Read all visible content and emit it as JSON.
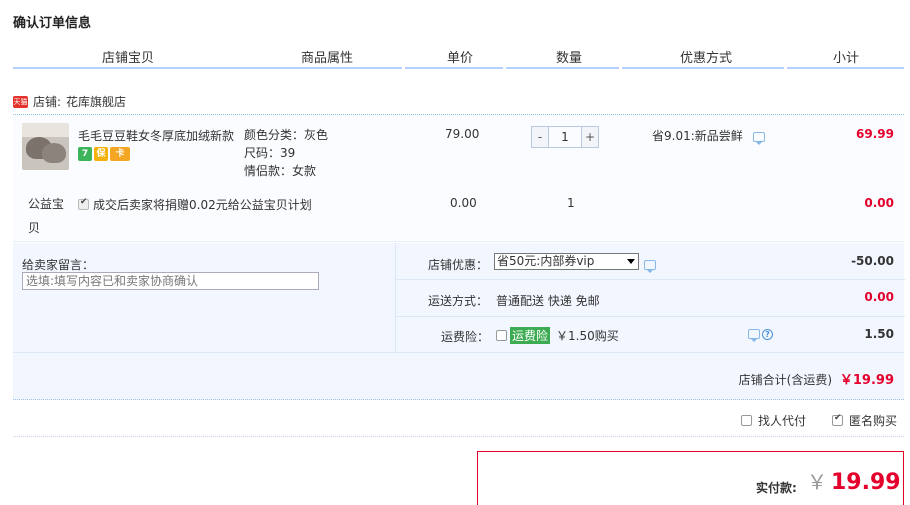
{
  "page": {
    "title": "确认订单信息"
  },
  "columns": [
    "店铺宝贝",
    "商品属性",
    "单价",
    "数量",
    "优惠方式",
    "小计"
  ],
  "shop": {
    "badge": "天猫",
    "label": "店铺:",
    "name": "花库旗舰店"
  },
  "item": {
    "title": "毛毛豆豆鞋女冬厚底加绒新款",
    "service_icons": [
      "7-day-return-icon",
      "guarantee-icon",
      "credit-card-icon"
    ],
    "service_glyphs": [
      "7",
      "保",
      "卡"
    ],
    "attrs": [
      "颜色分类：灰色",
      "尺码：39",
      "情侣款：女款"
    ],
    "price": "79.00",
    "qty_minus": "-",
    "qty": "1",
    "qty_plus": "+",
    "promo": "省9.01:新品尝鲜",
    "subtotal": "69.99"
  },
  "charity": {
    "label": "公益宝贝",
    "text": "成交后卖家将捐赠0.02元给公益宝贝计划",
    "price": "0.00",
    "qty": "1",
    "subtotal": "0.00"
  },
  "message": {
    "label": "给卖家留言：",
    "placeholder": "选填:填写内容已和卖家协商确认"
  },
  "discount": {
    "label": "店铺优惠：",
    "selected": "省50元:内部券vip",
    "amount": "-50.00"
  },
  "shipping": {
    "label": "运送方式：",
    "value": "普通配送 快递 免邮",
    "amount": "0.00"
  },
  "insurance": {
    "label": "运费险：",
    "tag": "运费险",
    "price": "￥1.50购买",
    "amount": "1.50"
  },
  "shop_total": {
    "label": "店铺合计(含运费)",
    "amount": "￥19.99"
  },
  "extras": {
    "proxy_pay": "找人代付",
    "anonymous": "匿名购买"
  },
  "payment": {
    "label": "实付款:",
    "currency": "￥",
    "amount": "19.99"
  },
  "colors": {
    "price_red": "#e4002b",
    "header_line": "#b2d1ff",
    "panel_bg": "#f2f7ff"
  }
}
